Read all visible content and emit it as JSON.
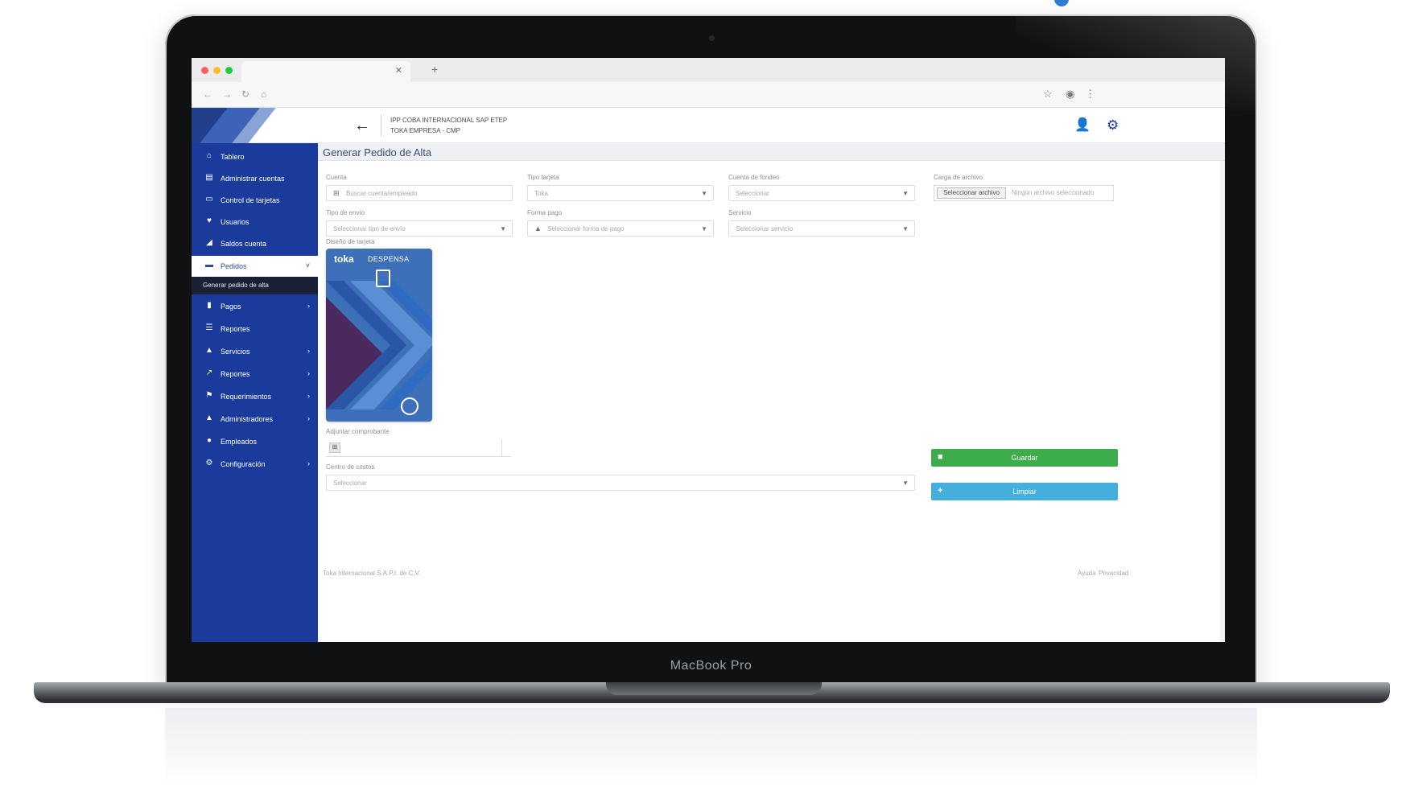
{
  "device": {
    "brand_text": "MacBook Pro"
  },
  "header": {
    "line1": "IPP COBA INTERNACIONAL SAP ETEP",
    "line2": "TOKA EMPRESA - CMP"
  },
  "sidebar": {
    "items": [
      {
        "label": "Tablero",
        "icon": "home-icon"
      },
      {
        "label": "Administrar cuentas",
        "icon": "card-icon"
      },
      {
        "label": "Control de tarjetas",
        "icon": "credit-card-icon"
      },
      {
        "label": "Usuarios",
        "icon": "users-icon"
      },
      {
        "label": "Saldos cuenta",
        "icon": "chart-icon"
      },
      {
        "label": "Pedidos",
        "icon": "cart-icon",
        "active": true
      },
      {
        "label": "Pagos",
        "icon": "document-icon"
      },
      {
        "label": "Reportes",
        "icon": "list-icon"
      },
      {
        "label": "Servicios",
        "icon": "service-icon"
      },
      {
        "label": "Reportes",
        "icon": "trend-icon"
      },
      {
        "label": "Requerimientos",
        "icon": "flag-icon"
      },
      {
        "label": "Administradores",
        "icon": "admin-icon"
      },
      {
        "label": "Empleados",
        "icon": "person-icon"
      },
      {
        "label": "Configuración",
        "icon": "gear-icon"
      }
    ],
    "submenu_label": "Generar pedido de alta"
  },
  "main": {
    "page_title": "Generar Pedido de Alta",
    "fields": {
      "cuenta": {
        "label": "Cuenta",
        "placeholder": "Buscar cuenta/empleado"
      },
      "tipo_tarjeta": {
        "label": "Tipo tarjeta",
        "value": "Toka"
      },
      "cuenta_fondeo": {
        "label": "Cuenta de fondeo",
        "value": "Seleccionar"
      },
      "carga_archivo": {
        "label": "Carga de archivo",
        "button": "Seleccionar archivo",
        "placeholder": "Ningún archivo seleccionado"
      },
      "tipo_envio": {
        "label": "Tipo de envío",
        "value": "Seleccionar tipo de envío"
      },
      "forma_pago": {
        "label": "Forma pago",
        "value": "Seleccionar forma de pago"
      },
      "servicio": {
        "label": "Servicio",
        "value": "Seleccionar servicio"
      },
      "diseno": {
        "label": "Diseño de tarjeta"
      },
      "comprobante": {
        "label": "Adjuntar comprobante"
      },
      "centro_costos": {
        "label": "Centro de costos",
        "value": "Seleccionar"
      }
    },
    "card": {
      "brand": "toka",
      "product": "DESPENSA"
    },
    "buttons": {
      "primary": "Guardar",
      "secondary": "Limpiar"
    },
    "footer": {
      "left": "Toka Internacional S.A.P.I. de C.V.",
      "right1": "Ayuda",
      "right2": "Privacidad"
    }
  }
}
